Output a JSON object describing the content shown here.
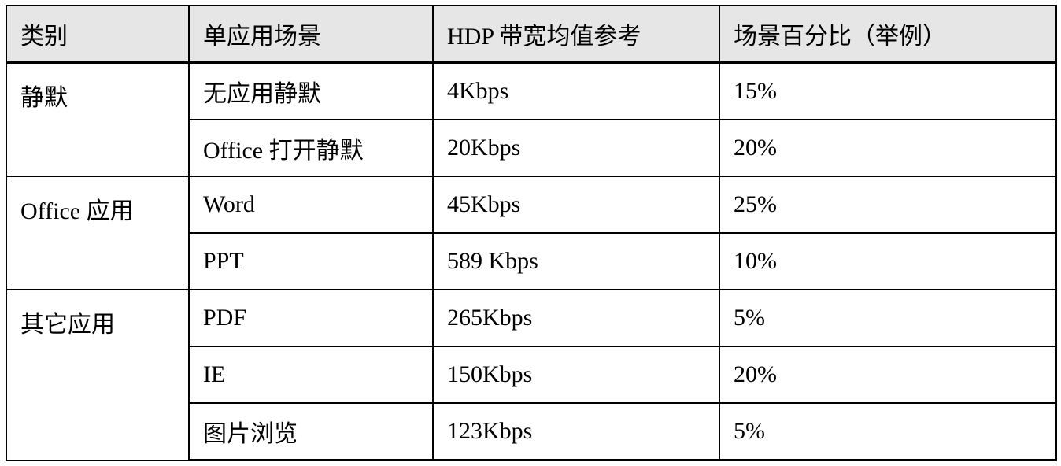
{
  "table": {
    "headers": [
      "类别",
      "单应用场景",
      "HDP 带宽均值参考",
      "场景百分比（举例）"
    ],
    "groups": [
      {
        "category": "静默",
        "rows": [
          {
            "scenario": "无应用静默",
            "bandwidth": "4Kbps",
            "percent": "15%"
          },
          {
            "scenario": "Office 打开静默",
            "bandwidth": "20Kbps",
            "percent": "20%"
          }
        ]
      },
      {
        "category": "Office 应用",
        "rows": [
          {
            "scenario": "Word",
            "bandwidth": "45Kbps",
            "percent": "25%"
          },
          {
            "scenario": "PPT",
            "bandwidth": "589 Kbps",
            "percent": "10%"
          }
        ]
      },
      {
        "category": "其它应用",
        "rows": [
          {
            "scenario": "PDF",
            "bandwidth": "265Kbps",
            "percent": "5%"
          },
          {
            "scenario": "IE",
            "bandwidth": "150Kbps",
            "percent": "20%"
          },
          {
            "scenario": "图片浏览",
            "bandwidth": "123Kbps",
            "percent": "5%"
          }
        ]
      }
    ]
  }
}
